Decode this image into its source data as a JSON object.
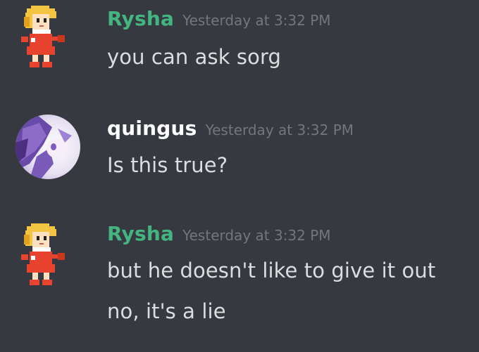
{
  "messages": [
    {
      "author": "Rysha",
      "author_color": "#43b581",
      "avatar_icon": "pixel-girl-avatar-icon",
      "timestamp": "Yesterday at 3:32 PM",
      "lines": [
        "you can ask sorg"
      ]
    },
    {
      "author": "quingus",
      "author_color": "#ffffff",
      "avatar_icon": "anime-character-avatar-icon",
      "timestamp": "Yesterday at 3:32 PM",
      "lines": [
        "Is this true?"
      ]
    },
    {
      "author": "Rysha",
      "author_color": "#43b581",
      "avatar_icon": "pixel-girl-avatar-icon",
      "timestamp": "Yesterday at 3:32 PM",
      "lines": [
        "but he doesn't like to give it out",
        "no, it's a lie"
      ]
    }
  ],
  "colors": {
    "background": "#36393f",
    "text": "#dcddde",
    "timestamp": "#72767d"
  }
}
